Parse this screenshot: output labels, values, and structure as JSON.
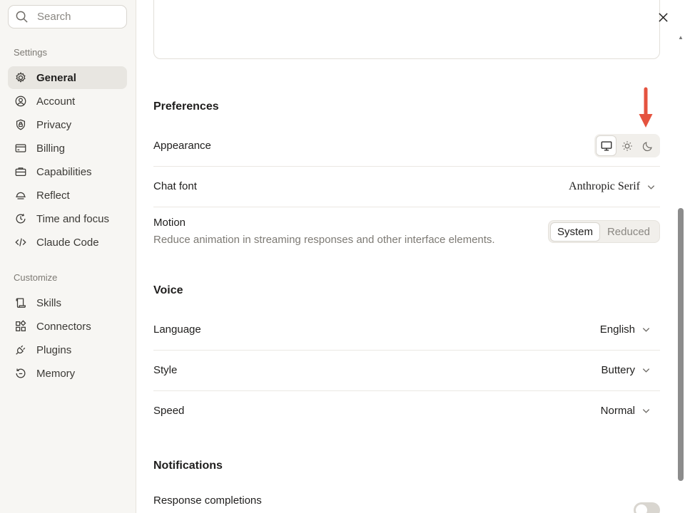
{
  "search": {
    "placeholder": "Search"
  },
  "sidebar": {
    "settings_label": "Settings",
    "customize_label": "Customize",
    "items": [
      {
        "label": "General",
        "icon": "gear-icon",
        "active": true
      },
      {
        "label": "Account",
        "icon": "user-circle-icon"
      },
      {
        "label": "Privacy",
        "icon": "shield-lock-icon"
      },
      {
        "label": "Billing",
        "icon": "credit-card-icon"
      },
      {
        "label": "Capabilities",
        "icon": "briefcase-icon"
      },
      {
        "label": "Reflect",
        "icon": "horizon-icon"
      },
      {
        "label": "Time and focus",
        "icon": "clock-icon"
      },
      {
        "label": "Claude Code",
        "icon": "code-icon"
      }
    ],
    "customize_items": [
      {
        "label": "Skills",
        "icon": "scroll-icon"
      },
      {
        "label": "Connectors",
        "icon": "blocks-icon"
      },
      {
        "label": "Plugins",
        "icon": "plug-icon"
      },
      {
        "label": "Memory",
        "icon": "history-icon"
      }
    ]
  },
  "preferences": {
    "title": "Preferences",
    "appearance_label": "Appearance",
    "appearance_options": [
      "system-monitor-icon",
      "sun-icon",
      "moon-icon"
    ],
    "appearance_selected": "system",
    "chat_font_label": "Chat font",
    "chat_font_value": "Anthropic Serif",
    "motion_label": "Motion",
    "motion_desc": "Reduce animation in streaming responses and other interface elements.",
    "motion_options": [
      "System",
      "Reduced"
    ],
    "motion_selected": "System"
  },
  "voice": {
    "title": "Voice",
    "language_label": "Language",
    "language_value": "English",
    "style_label": "Style",
    "style_value": "Buttery",
    "speed_label": "Speed",
    "speed_value": "Normal"
  },
  "notifications": {
    "title": "Notifications",
    "response_completions_label": "Response completions",
    "response_completions_on": false
  },
  "colors": {
    "sidebar_bg": "#f7f6f3",
    "active_item_bg": "#e8e6e1",
    "annotation_arrow": "#e5533f"
  }
}
